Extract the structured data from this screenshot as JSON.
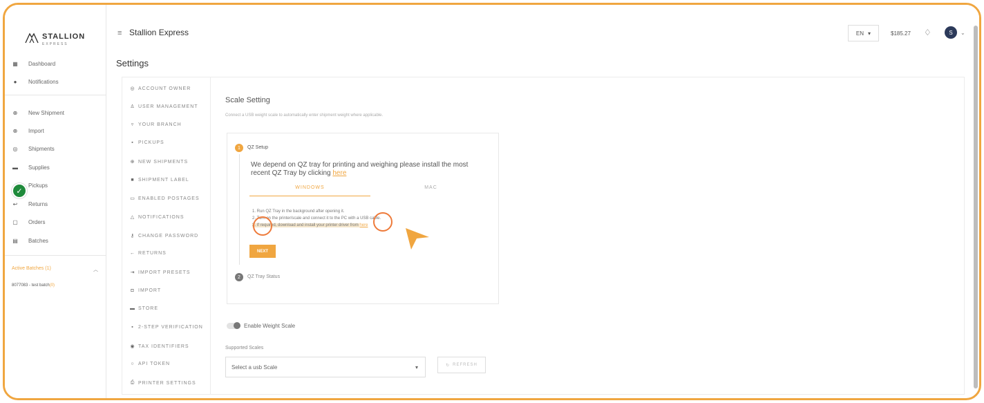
{
  "brand": {
    "name": "STALLION",
    "sub": "EXPRESS"
  },
  "topbar": {
    "title": "Stallion Express",
    "language": "EN",
    "balance": "$185.27",
    "avatar_letter": "S"
  },
  "sidebar": {
    "items": [
      {
        "label": "Dashboard",
        "icon": "grid-icon"
      },
      {
        "label": "Notifications",
        "icon": "bell-icon"
      },
      {
        "label": "New Shipment",
        "icon": "plus-circle-icon"
      },
      {
        "label": "Import",
        "icon": "import-icon"
      },
      {
        "label": "Shipments",
        "icon": "box-icon"
      },
      {
        "label": "Supplies",
        "icon": "cart-icon"
      },
      {
        "label": "Pickups",
        "icon": "truck-icon"
      },
      {
        "label": "Returns",
        "icon": "return-icon"
      },
      {
        "label": "Orders",
        "icon": "orders-icon"
      },
      {
        "label": "Batches",
        "icon": "batches-icon"
      }
    ],
    "active_batches": "Active Batches (1)",
    "batch_line": "8077083 - test batch",
    "batch_count": "(0)"
  },
  "page": {
    "title": "Settings"
  },
  "settings_nav": [
    {
      "label": "Account Owner",
      "icon": "user-circle-icon"
    },
    {
      "label": "User Management",
      "icon": "users-icon"
    },
    {
      "label": "Your Branch",
      "icon": "location-icon"
    },
    {
      "label": "Pickups",
      "icon": "truck-icon"
    },
    {
      "label": "New Shipments",
      "icon": "plus-circle-icon"
    },
    {
      "label": "Shipment Label",
      "icon": "label-icon"
    },
    {
      "label": "Enabled Postages",
      "icon": "postage-icon"
    },
    {
      "label": "Notifications",
      "icon": "bell-icon"
    },
    {
      "label": "Change Password",
      "icon": "key-icon"
    },
    {
      "label": "Returns",
      "icon": "arrow-left-icon"
    },
    {
      "label": "Import Presets",
      "icon": "preset-icon"
    },
    {
      "label": "Import",
      "icon": "import-icon"
    },
    {
      "label": "Store",
      "icon": "store-icon"
    },
    {
      "label": "2-Step Verification",
      "icon": "shield-icon"
    },
    {
      "label": "Tax Identifiers",
      "icon": "globe-icon"
    },
    {
      "label": "API Token",
      "icon": "token-icon"
    },
    {
      "label": "Printer Settings",
      "icon": "printer-icon"
    }
  ],
  "scale": {
    "title": "Scale Setting",
    "description": "Connect a USB weight scale to automatically enter shipment weight where applicable.",
    "step1_label": "QZ Setup",
    "step1_num": "1",
    "qz_text": "We depend on QZ tray for printing and weighing please install the most recent QZ Tray by clicking ",
    "qz_link": "here",
    "tab_windows": "WINDOWS",
    "tab_mac": "MAC",
    "instruction1": "1. Run QZ Tray in the background after opening it.",
    "instruction2": "2. Turn on the printer/scale and connect it to the PC with a USB cable.",
    "instruction3_prefix": "3. If required, download and install your printer driver from ",
    "instruction3_link": "here",
    "next_label": "NEXT",
    "step2_num": "2",
    "step2_label": "QZ Tray Status",
    "toggle_label": "Enable Weight Scale",
    "supported_label": "Supported Scales",
    "select_placeholder": "Select a usb Scale",
    "refresh_label": "REFRESH"
  },
  "colors": {
    "accent": "#f0a640",
    "frame": "#f0a640",
    "annotation": "#ee7a3a",
    "success": "#1f8a3b"
  }
}
